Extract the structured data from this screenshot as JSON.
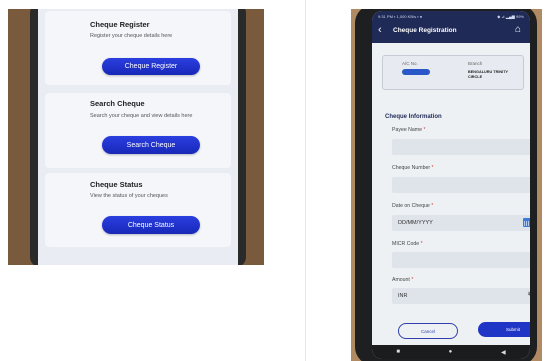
{
  "left_screen": {
    "cards": [
      {
        "title": "Cheque Register",
        "description": "Register your cheque details here",
        "button": "Cheque Register"
      },
      {
        "title": "Search Cheque",
        "description": "Search your cheque and view details here",
        "button": "Search Cheque"
      },
      {
        "title": "Cheque Status",
        "description": "View the status of your cheques",
        "button": "Cheque Status"
      }
    ]
  },
  "right_screen": {
    "status_bar": {
      "left": "9:31 PM ▪ 1,000 KB/s ▪ ●",
      "right": "◆ ⊿ ▂▄▆ 99%"
    },
    "app_bar": {
      "title": "Cheque Registration"
    },
    "account": {
      "ac_label": "A/C No.",
      "branch_label": "Branch",
      "branch_value": "BENGALURU TRINITY CIRCLE"
    },
    "section_title": "Cheque Information",
    "fields": {
      "payee_label": "Payee Name",
      "cheque_number_label": "Cheque Number",
      "date_label": "Date on Cheque",
      "date_placeholder": "DD/MM/YYYY",
      "micr_label": "MICR Code",
      "amount_label": "Amount",
      "amount_value": "INR",
      "required_mark": "*"
    },
    "buttons": {
      "cancel": "Cancel",
      "submit": "Submit"
    },
    "nav": {
      "recent": "■",
      "home": "●",
      "back": "◀"
    }
  },
  "colors": {
    "accent_blue": "#1f35c6",
    "app_bar": "#1f2a57",
    "required": "#d23a3a"
  },
  "icons": [
    "back-arrow-icon",
    "home-icon",
    "calendar-icon",
    "rupee-icon"
  ]
}
